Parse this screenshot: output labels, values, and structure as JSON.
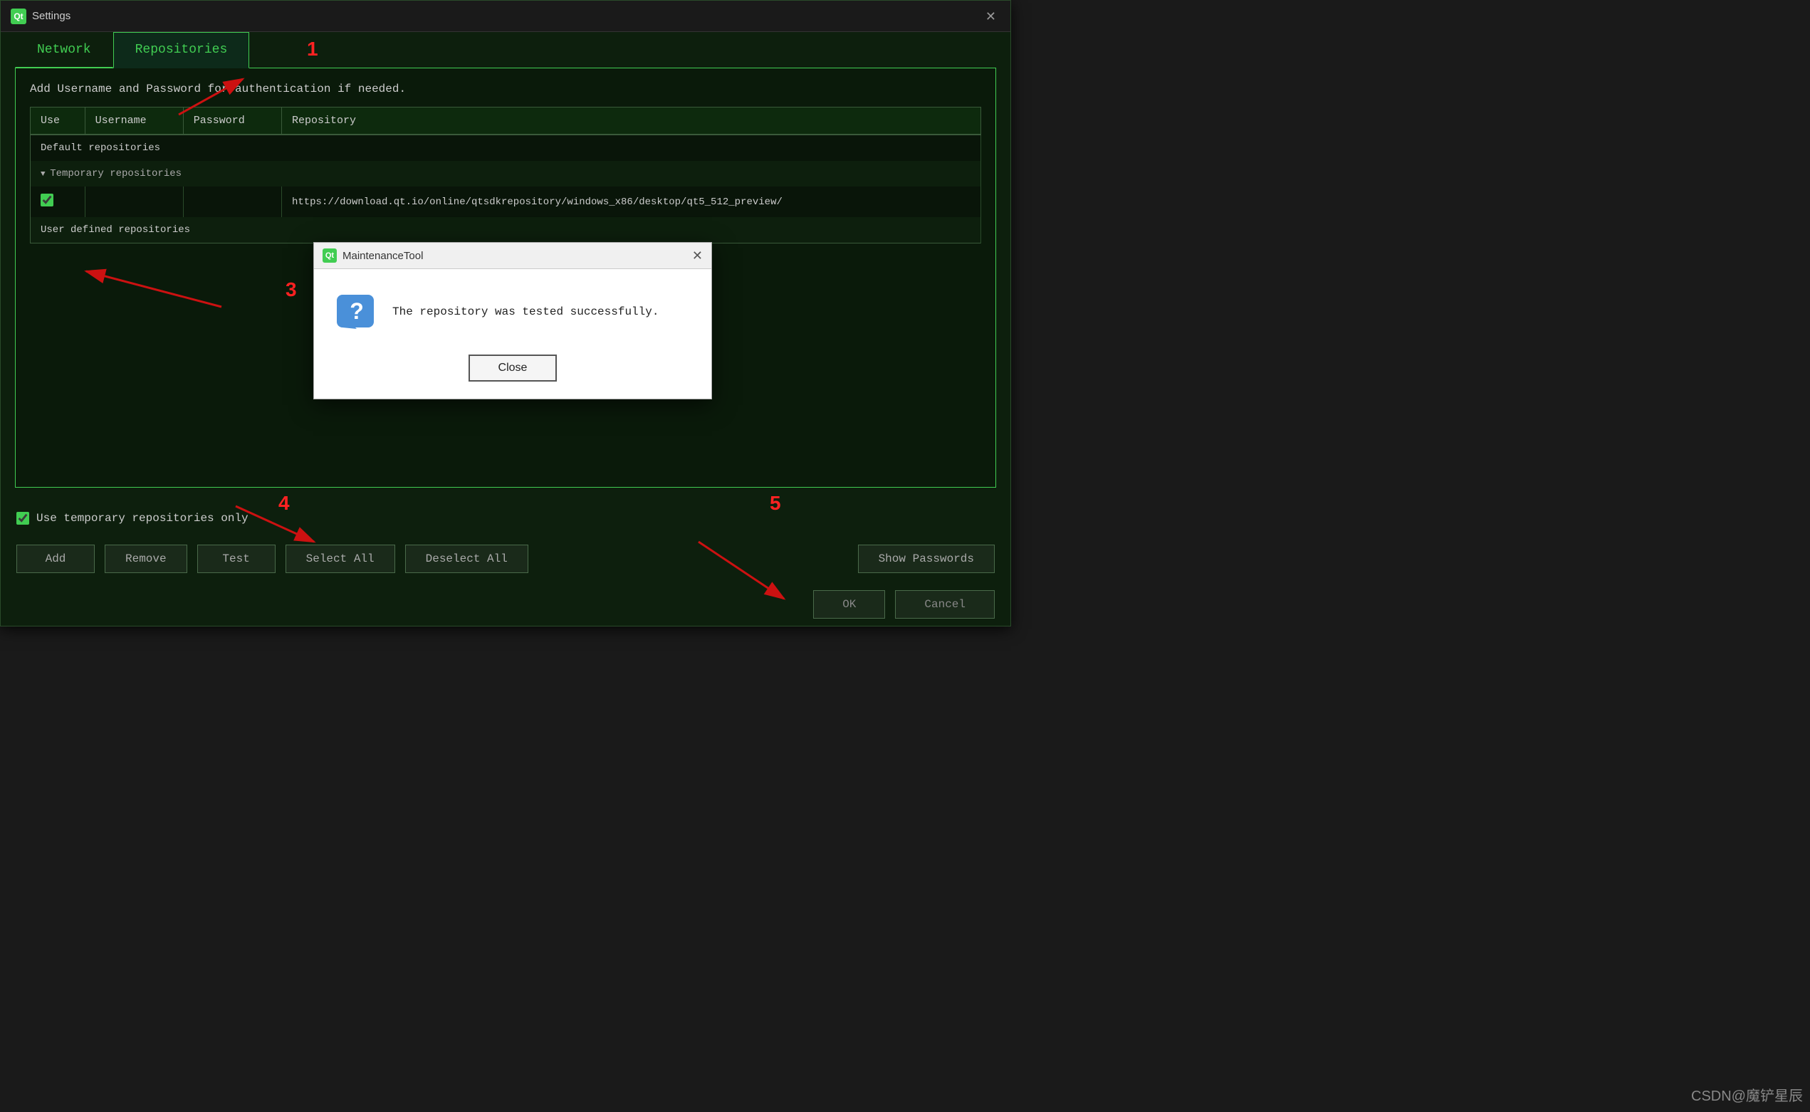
{
  "window": {
    "title": "Settings",
    "logo": "Qt",
    "close_label": "✕"
  },
  "tabs": [
    {
      "id": "network",
      "label": "Network",
      "active": false
    },
    {
      "id": "repositories",
      "label": "Repositories",
      "active": true
    }
  ],
  "repositories": {
    "description": "Add Username and Password for authentication if needed.",
    "table": {
      "columns": [
        "Use",
        "Username",
        "Password",
        "Repository"
      ],
      "groups": [
        {
          "label": "Default repositories",
          "collapsible": false,
          "rows": []
        },
        {
          "label": "Temporary repositories",
          "collapsible": true,
          "rows": [
            {
              "checked": true,
              "username": "",
              "password": "",
              "url": "https://download.qt.io/online/qtsdkrepository/windows_x86/desktop/qt5_512_preview/"
            }
          ]
        },
        {
          "label": "User defined repositories",
          "collapsible": false,
          "rows": []
        }
      ]
    },
    "use_temp_only_label": "Use temporary repositories only",
    "use_temp_only_checked": true,
    "buttons": [
      "Add",
      "Remove",
      "Test",
      "Select All",
      "Deselect All",
      "Show Passwords"
    ],
    "ok_label": "OK",
    "cancel_label": "Cancel"
  },
  "dialog": {
    "title": "MaintenanceTool",
    "logo": "Qt",
    "close_label": "✕",
    "message": "The repository was tested successfully.",
    "close_button": "Close"
  },
  "annotations": {
    "numbers": [
      "1",
      "3",
      "4",
      "5"
    ],
    "colors": {
      "arrow": "#cc1111",
      "number": "#cc1111"
    }
  }
}
